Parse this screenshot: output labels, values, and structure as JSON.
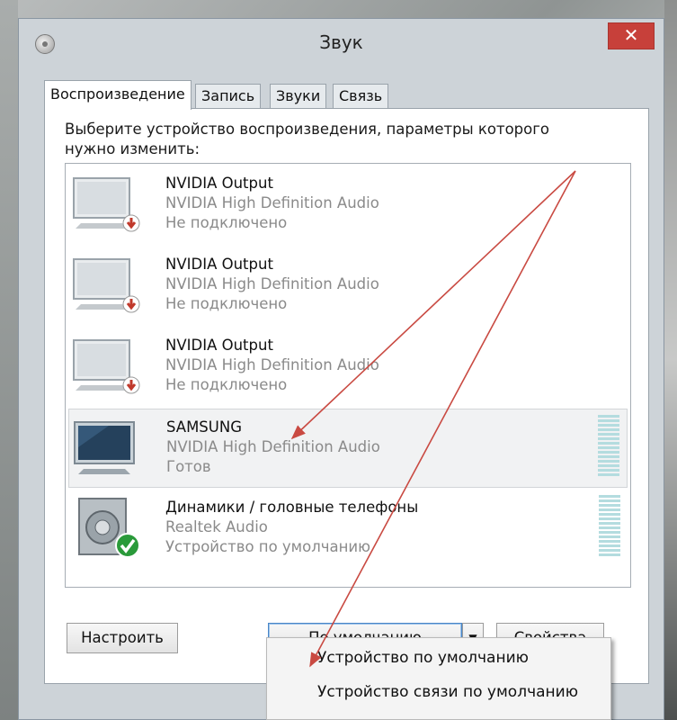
{
  "window": {
    "title": "Звук",
    "close_glyph": "✕"
  },
  "tabs": [
    {
      "label": "Воспроизведение",
      "active": true
    },
    {
      "label": "Запись"
    },
    {
      "label": "Звуки"
    },
    {
      "label": "Связь"
    }
  ],
  "prompt": "Выберите устройство воспроизведения, параметры которого нужно изменить:",
  "devices": [
    {
      "name": "NVIDIA Output",
      "driver": "NVIDIA High Definition Audio",
      "status": "Не подключено",
      "icon": "monitor-disconnected-icon"
    },
    {
      "name": "NVIDIA Output",
      "driver": "NVIDIA High Definition Audio",
      "status": "Не подключено",
      "icon": "monitor-disconnected-icon"
    },
    {
      "name": "NVIDIA Output",
      "driver": "NVIDIA High Definition Audio",
      "status": "Не подключено",
      "icon": "monitor-disconnected-icon"
    },
    {
      "name": "SAMSUNG",
      "driver": "NVIDIA High Definition Audio",
      "status": "Готов",
      "icon": "tv-monitor-icon",
      "selected": true
    },
    {
      "name": "Динамики / головные телефоны",
      "driver": "Realtek Audio",
      "status": "Устройство по умолчанию",
      "icon": "speaker-default-icon"
    }
  ],
  "buttons": {
    "configure": "Настроить",
    "default": "По умолчанию",
    "default_arrow": "▼",
    "properties": "Свойства"
  },
  "dropdown_menu": [
    "Устройство по умолчанию",
    "Устройство связи по умолчанию"
  ],
  "colors": {
    "close_button": "#c7403a",
    "annotation_arrow": "#c94a42",
    "level_meter": "#b4dcdf",
    "default_check": "#2a9a3a",
    "disconnected_badge": "#c0392b"
  }
}
